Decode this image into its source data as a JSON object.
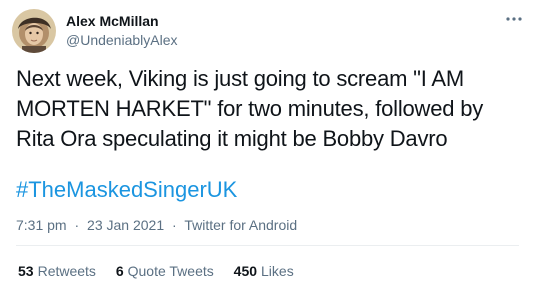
{
  "tweet": {
    "author": {
      "display_name": "Alex McMillan",
      "handle": "@UndeniablyAlex"
    },
    "text": "Next week, Viking is just going to scream \"I AM MORTEN HARKET\" for two minutes, followed by Rita Ora speculating it might be Bobby Davro",
    "hashtag": "#TheMaskedSingerUK",
    "time": "7:31 pm",
    "separator": "·",
    "date": "23 Jan 2021",
    "source": "Twitter for Android",
    "stats": {
      "retweets_count": "53",
      "retweets_label": "Retweets",
      "quotes_count": "6",
      "quotes_label": "Quote Tweets",
      "likes_count": "450",
      "likes_label": "Likes"
    }
  },
  "icons": {
    "more": "more-horizontal-icon",
    "avatar": "avatar-portrait"
  },
  "colors": {
    "hashtag": "#1b95e0",
    "secondary_text": "#5b7083",
    "primary_text": "#0f1419",
    "divider": "#ebeef0"
  }
}
